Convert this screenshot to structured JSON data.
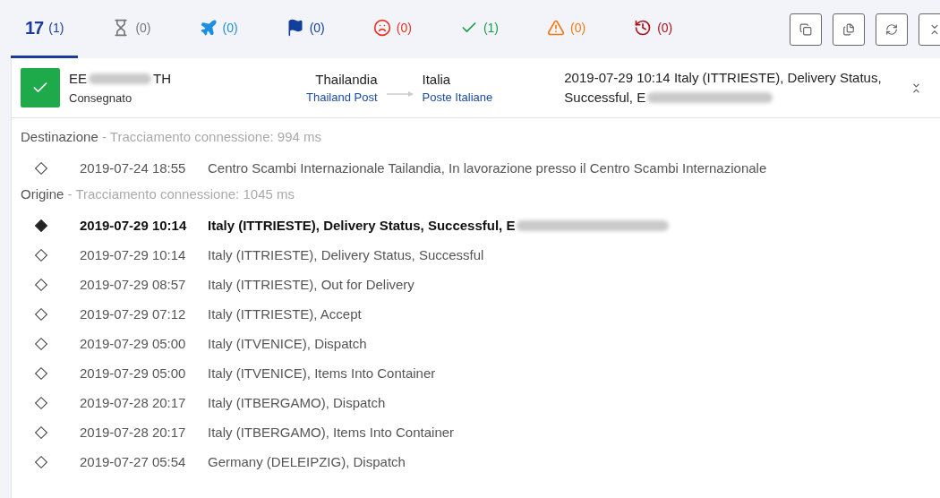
{
  "tabs": [
    {
      "kind": "logo",
      "logo": "17",
      "count": "(1)",
      "selected": true
    },
    {
      "kind": "pending",
      "count": "(0)",
      "selected": false
    },
    {
      "kind": "transit",
      "count": "(0)",
      "selected": false
    },
    {
      "kind": "pickup",
      "count": "(0)",
      "selected": false
    },
    {
      "kind": "undelivered",
      "count": "(0)",
      "selected": false
    },
    {
      "kind": "delivered",
      "count": "(1)",
      "selected": false
    },
    {
      "kind": "alert",
      "count": "(0)",
      "selected": false
    },
    {
      "kind": "expired",
      "count": "(0)",
      "selected": false
    }
  ],
  "toolbar": [
    {
      "kind": "copy"
    },
    {
      "kind": "copy-list"
    },
    {
      "kind": "refresh"
    },
    {
      "kind": "collapse"
    }
  ],
  "shipment": {
    "delivered": true,
    "number_start": "EE",
    "number_end": "TH",
    "status": "Consegnato",
    "origin_country": "Thailandia",
    "origin_carrier": "Thailand Post",
    "destination_country": "Italia",
    "destination_carrier": "Poste Italiane",
    "latest_lines": [
      "2019-07-29 10:14  Italy (ITTRIESTE), Delivery Status,",
      "Successful, E"
    ],
    "expanded": true
  },
  "sections": [
    {
      "title": "Destinazione",
      "note": " - Tracciamento connessione: 994 ms",
      "events": [
        {
          "time": "2019-07-24 18:55",
          "text": "Centro Scambi Internazionale Tailandia, In lavorazione presso il Centro Scambi Internazionale",
          "latest": false,
          "redacted": false
        }
      ]
    },
    {
      "title": "Origine",
      "note": " - Tracciamento connessione: 1045 ms",
      "events": [
        {
          "time": "2019-07-29 10:14",
          "text": "Italy (ITTRIESTE), Delivery Status, Successful, E",
          "latest": true,
          "redacted": true
        },
        {
          "time": "2019-07-29 10:14",
          "text": "Italy (ITTRIESTE), Delivery Status, Successful",
          "latest": false,
          "redacted": false
        },
        {
          "time": "2019-07-29 08:57",
          "text": "Italy (ITTRIESTE), Out for Delivery",
          "latest": false,
          "redacted": false
        },
        {
          "time": "2019-07-29 07:12",
          "text": "Italy (ITTRIESTE), Accept",
          "latest": false,
          "redacted": false
        },
        {
          "time": "2019-07-29 05:00",
          "text": "Italy (ITVENICE), Dispatch",
          "latest": false,
          "redacted": false
        },
        {
          "time": "2019-07-29 05:00",
          "text": "Italy (ITVENICE), Items Into Container",
          "latest": false,
          "redacted": false
        },
        {
          "time": "2019-07-28 20:17",
          "text": "Italy (ITBERGAMO), Dispatch",
          "latest": false,
          "redacted": false
        },
        {
          "time": "2019-07-28 20:17",
          "text": "Italy (ITBERGAMO), Items Into Container",
          "latest": false,
          "redacted": false
        },
        {
          "time": "2019-07-27 05:54",
          "text": "Germany (DELEIPZIG), Dispatch",
          "latest": false,
          "redacted": false
        }
      ]
    }
  ]
}
